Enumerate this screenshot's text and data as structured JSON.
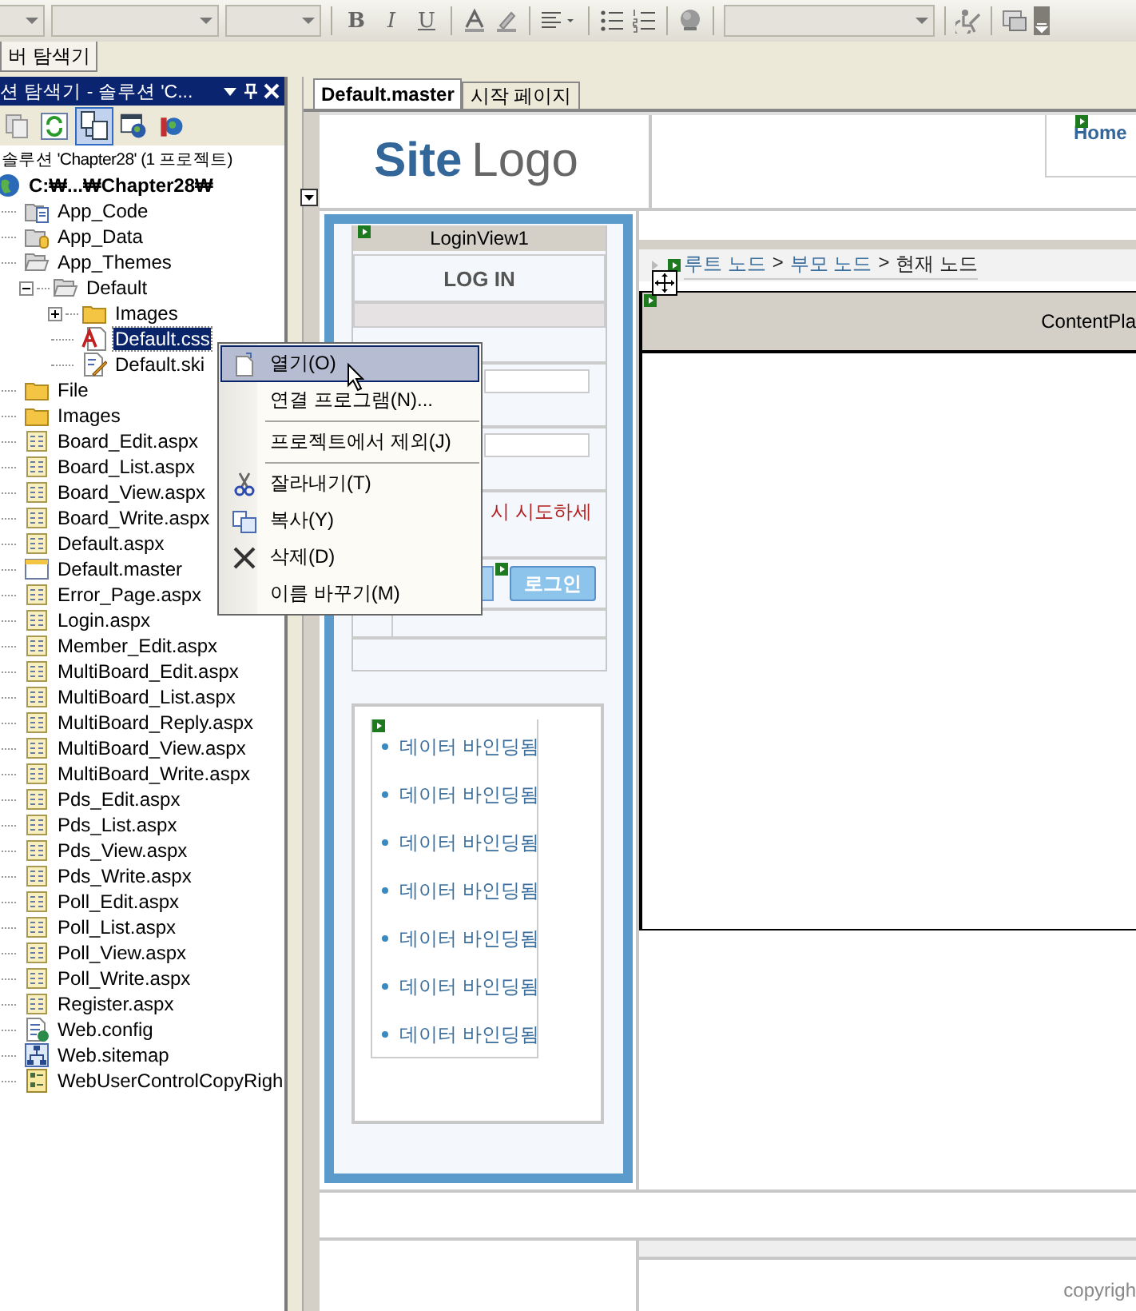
{
  "toolbar": {
    "buttons": [
      {
        "label": "B"
      },
      {
        "label": "I"
      },
      {
        "label": "U"
      }
    ]
  },
  "panel_tab": "버 탐색기",
  "solution_explorer": {
    "title": "션 탐색기 - 솔루션 'C...",
    "tree": [
      {
        "label": "솔루션 'Chapter28' (1 프로젝트)",
        "selected": false,
        "children": [
          {
            "label": "C:₩...₩Chapter28₩",
            "kind": "project",
            "selected": false,
            "children": [
              {
                "label": "App_Code",
                "kind": "code-folder",
                "selected": false
              },
              {
                "label": "App_Data",
                "kind": "data-folder",
                "selected": false
              },
              {
                "label": "App_Themes",
                "kind": "open-folder",
                "selected": false,
                "children": [
                  {
                    "label": "Default",
                    "kind": "open-folder",
                    "expanded": true,
                    "selected": false,
                    "children": [
                      {
                        "label": "Images",
                        "kind": "folder",
                        "expanded": false,
                        "selected": false
                      },
                      {
                        "label": "Default.css",
                        "kind": "css",
                        "selected": true
                      },
                      {
                        "label": "Default.ski",
                        "kind": "skin",
                        "selected": false
                      }
                    ]
                  }
                ]
              },
              {
                "label": "File",
                "kind": "folder",
                "selected": false
              },
              {
                "label": "Images",
                "kind": "folder",
                "selected": false
              },
              {
                "label": "Board_Edit.aspx",
                "kind": "page",
                "selected": false
              },
              {
                "label": "Board_List.aspx",
                "kind": "page",
                "selected": false
              },
              {
                "label": "Board_View.aspx",
                "kind": "page",
                "selected": false
              },
              {
                "label": "Board_Write.aspx",
                "kind": "page",
                "selected": false
              },
              {
                "label": "Default.aspx",
                "kind": "page",
                "selected": false
              },
              {
                "label": "Default.master",
                "kind": "master",
                "selected": false
              },
              {
                "label": "Error_Page.aspx",
                "kind": "page",
                "selected": false
              },
              {
                "label": "Login.aspx",
                "kind": "page",
                "selected": false
              },
              {
                "label": "Member_Edit.aspx",
                "kind": "page",
                "selected": false
              },
              {
                "label": "MultiBoard_Edit.aspx",
                "kind": "page",
                "selected": false
              },
              {
                "label": "MultiBoard_List.aspx",
                "kind": "page",
                "selected": false
              },
              {
                "label": "MultiBoard_Reply.aspx",
                "kind": "page",
                "selected": false
              },
              {
                "label": "MultiBoard_View.aspx",
                "kind": "page",
                "selected": false
              },
              {
                "label": "MultiBoard_Write.aspx",
                "kind": "page",
                "selected": false
              },
              {
                "label": "Pds_Edit.aspx",
                "kind": "page",
                "selected": false
              },
              {
                "label": "Pds_List.aspx",
                "kind": "page",
                "selected": false
              },
              {
                "label": "Pds_View.aspx",
                "kind": "page",
                "selected": false
              },
              {
                "label": "Pds_Write.aspx",
                "kind": "page",
                "selected": false
              },
              {
                "label": "Poll_Edit.aspx",
                "kind": "page",
                "selected": false
              },
              {
                "label": "Poll_List.aspx",
                "kind": "page",
                "selected": false
              },
              {
                "label": "Poll_View.aspx",
                "kind": "page",
                "selected": false
              },
              {
                "label": "Poll_Write.aspx",
                "kind": "page",
                "selected": false
              },
              {
                "label": "Register.aspx",
                "kind": "page",
                "selected": false
              },
              {
                "label": "Web.config",
                "kind": "config",
                "selected": false
              },
              {
                "label": "Web.sitemap",
                "kind": "sitemap",
                "selected": false
              },
              {
                "label": "WebUserControlCopyRigh",
                "kind": "control",
                "selected": false
              }
            ]
          }
        ]
      }
    ]
  },
  "document_tabs": [
    {
      "label": "Default.master",
      "selected": true
    },
    {
      "label": "시작 페이지",
      "selected": false
    }
  ],
  "design": {
    "logo_bold": "Site",
    "logo_light": "Logo",
    "home_link": "Home",
    "login_view": {
      "title": "LoginView1",
      "heading": "LOG IN",
      "error": "시 시도하세",
      "button": "로그인"
    },
    "breadcrumb": [
      {
        "label": "루트 노드",
        "kind": "link"
      },
      {
        "label": ">",
        "kind": "separator"
      },
      {
        "label": "부모 노드",
        "kind": "link"
      },
      {
        "label": ">",
        "kind": "separator"
      },
      {
        "label": "현재 노드",
        "kind": "current"
      }
    ],
    "content_placeholder": "ContentPla",
    "bound_items": [
      "데이터 바인딩됨",
      "데이터 바인딩됨",
      "데이터 바인딩됨",
      "데이터 바인딩됨",
      "데이터 바인딩됨",
      "데이터 바인딩됨",
      "데이터 바인딩됨"
    ],
    "footer": "copyrigh"
  },
  "context_menu": {
    "items": [
      {
        "label": "열기(O)",
        "kind": "open",
        "selected": true,
        "separator_after": false
      },
      {
        "label": "연결 프로그램(N)...",
        "kind": "plain",
        "selected": false,
        "separator_after": true
      },
      {
        "label": "프로젝트에서 제외(J)",
        "kind": "plain",
        "selected": false,
        "separator_after": true
      },
      {
        "label": "잘라내기(T)",
        "kind": "cut",
        "selected": false,
        "separator_after": false
      },
      {
        "label": "복사(Y)",
        "kind": "copy",
        "selected": false,
        "separator_after": false
      },
      {
        "label": "삭제(D)",
        "kind": "delete",
        "selected": false,
        "separator_after": false
      },
      {
        "label": "이름 바꾸기(M)",
        "kind": "plain",
        "selected": false,
        "separator_after": false
      }
    ]
  }
}
